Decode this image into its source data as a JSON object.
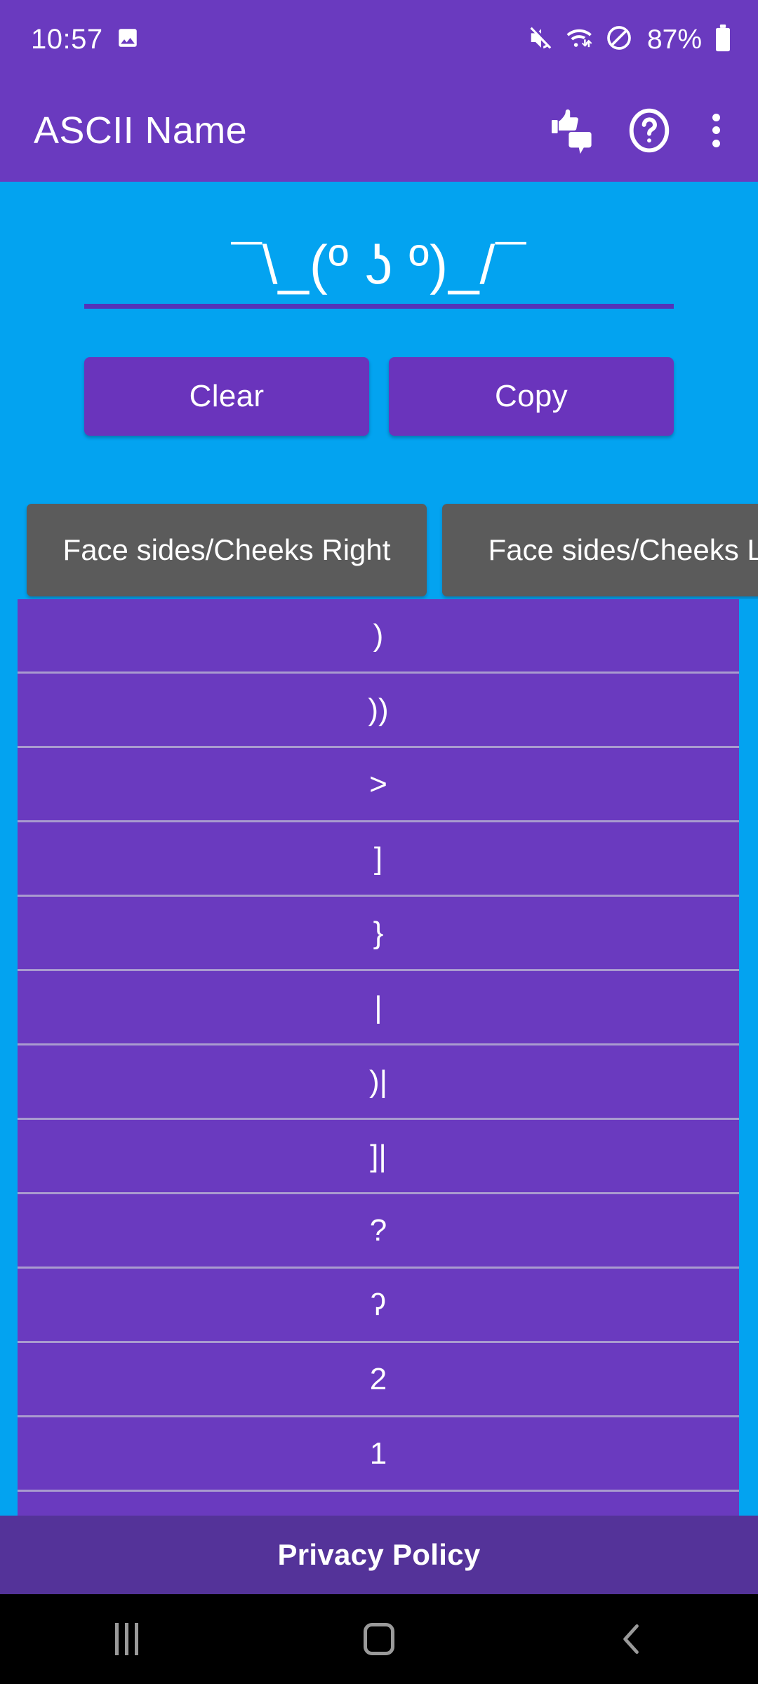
{
  "statusbar": {
    "time": "10:57",
    "battery_percent": "87%",
    "icons": [
      "image-icon",
      "mute-icon",
      "wifi-icon",
      "do-not-disturb-icon",
      "battery-icon"
    ]
  },
  "appbar": {
    "title": "ASCII Name",
    "actions": [
      "feedback-icon",
      "help-icon",
      "overflow-menu-icon"
    ],
    "background": "#6A3ABF"
  },
  "display": {
    "ascii_text": "¯\\_(º ʖ º)_/¯"
  },
  "buttons": {
    "clear_label": "Clear",
    "copy_label": "Copy"
  },
  "tabs": [
    {
      "label": "Face sides/Cheeks Right",
      "selected": false
    },
    {
      "label": "Face sides/Cheeks Left",
      "selected": false
    }
  ],
  "list": {
    "items": [
      {
        "value": ")"
      },
      {
        "value": "))"
      },
      {
        "value": ">"
      },
      {
        "value": "]"
      },
      {
        "value": "}"
      },
      {
        "value": "|"
      },
      {
        "value": ")|"
      },
      {
        "value": "]|"
      },
      {
        "value": "?"
      },
      {
        "value": "ʔ"
      },
      {
        "value": "2"
      },
      {
        "value": "1"
      },
      {
        "value": "."
      }
    ]
  },
  "footer": {
    "privacy_policy_label": "Privacy Policy"
  },
  "navbar": {
    "recents_label": "|||",
    "home_label": "home",
    "back_label": "<"
  },
  "colors": {
    "primary_purple": "#6A3ABF",
    "accent_blue": "#03A3F0",
    "button_purple": "#6A34BC",
    "tab_grey": "#5B5B5B",
    "footer_purple": "#543399",
    "divider": "#A99BCF"
  }
}
